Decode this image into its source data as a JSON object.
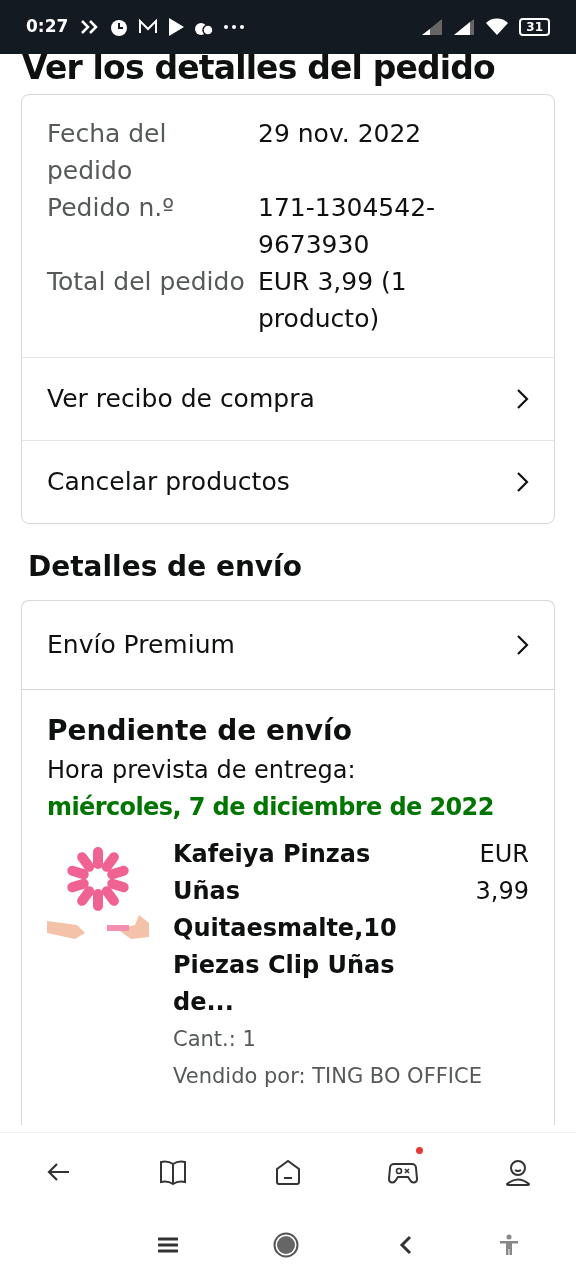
{
  "status_bar": {
    "time": "0:27",
    "battery": "31"
  },
  "title": "Ver los detalles del pedido",
  "order_summary": {
    "fields": [
      {
        "label": "Fecha del pedido",
        "value": "29 nov. 2022"
      },
      {
        "label": "Pedido n.º",
        "value": "171-1304542-9673930"
      },
      {
        "label": "Total del pedido",
        "value": "EUR 3,99 (1 producto)"
      }
    ],
    "links": [
      "Ver recibo de compra",
      "Cancelar productos"
    ]
  },
  "shipping": {
    "heading": "Detalles de envío",
    "method": "Envío Premium",
    "status": "Pendiente de envío",
    "eta_label": "Hora prevista de entrega:",
    "eta_date": "miércoles, 7 de diciembre de 2022",
    "product": {
      "kind": "picture",
      "title": "Kafeiya Pinzas Uñas Quitaesmalte,10 Piezas Clip Uñas de...",
      "price": "EUR 3,99",
      "quantity": "Cant.: 1",
      "seller": "Vendido por: TING BO OFFICE"
    }
  },
  "bottom_nav": [
    {
      "kind": "back",
      "badge": false
    },
    {
      "kind": "book",
      "badge": false
    },
    {
      "kind": "home",
      "badge": false
    },
    {
      "kind": "game",
      "badge": true
    },
    {
      "kind": "profile",
      "badge": false
    }
  ]
}
